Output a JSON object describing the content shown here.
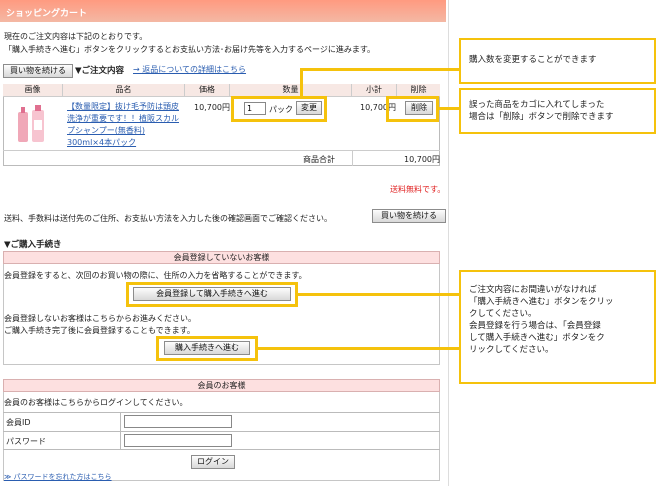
{
  "header": {
    "title": "ショッピングカート"
  },
  "intro": {
    "line1": "現在のご注文内容は下記のとおりです。",
    "line2": "「購入手続きへ進む」ボタンをクリックするとお支払い方法･お届け先等を入力するページに進みます。"
  },
  "order": {
    "continue_button": "買い物を続ける",
    "section_title": "▼ご注文内容",
    "return_link": "→ 返品についての詳細はこちら"
  },
  "cart_table": {
    "headers": [
      "画像",
      "品名",
      "価格",
      "数量",
      "小計",
      "削除"
    ],
    "item": {
      "name": "【数量限定】抜け毛予防は頭皮洗浄が重要です！！植阪スカルプシャンプー(無香料) 300ml×4本パック",
      "price": "10,700円",
      "quantity": "1",
      "unit": "パック",
      "change_button": "変更",
      "subtotal": "10,700円",
      "delete_button": "削除"
    },
    "total_label": "商品合計",
    "total_value": "10,700円"
  },
  "shipping": {
    "free_text": "送料無料です。",
    "note": "送料、手数料は送付先のご住所、お支払い方法を入力した後の確認画面でご確認ください。",
    "continue_button": "買い物を続ける"
  },
  "purchase": {
    "section_title": "▼ご購入手続き",
    "non_member": {
      "title": "会員登録していないお客様",
      "text1": "会員登録をすると、次回のお買い物の際に、住所の入力を省略することができます。",
      "register_button": "会員登録して購入手続きへ進む",
      "text2": "会員登録しないお客様はこちらからお進みください。",
      "text3": "ご購入手続き完了後に会員登録することもできます。",
      "proceed_button": "購入手続きへ進む"
    },
    "member": {
      "title": "会員のお客様",
      "text": "会員のお客様はこちらからログインしてください。",
      "id_label": "会員ID",
      "password_label": "パスワード",
      "login_button": "ログイン",
      "forgot_link": "≫ パスワードを忘れた方はこちら"
    }
  },
  "callouts": {
    "quantity": "購入数を変更することができます",
    "delete_line1": "誤った商品をカゴに入れてしまった",
    "delete_line2": "場合は「削除」ボタンで削除できます",
    "proceed_line1": "ご注文内容にお間違いがなければ",
    "proceed_line2": "「購入手続きへ進む」ボタンをクリッ",
    "proceed_line3": "クしてください。",
    "proceed_line4": "会員登録を行う場合は、「会員登録",
    "proceed_line5": "して購入手続きへ進む」ボタンをク",
    "proceed_line6": "リックしてください。"
  },
  "colors": {
    "accent": "#f5c20c",
    "header": "#ff9a80",
    "free_shipping": "#e02020",
    "link": "#2a5db0"
  }
}
